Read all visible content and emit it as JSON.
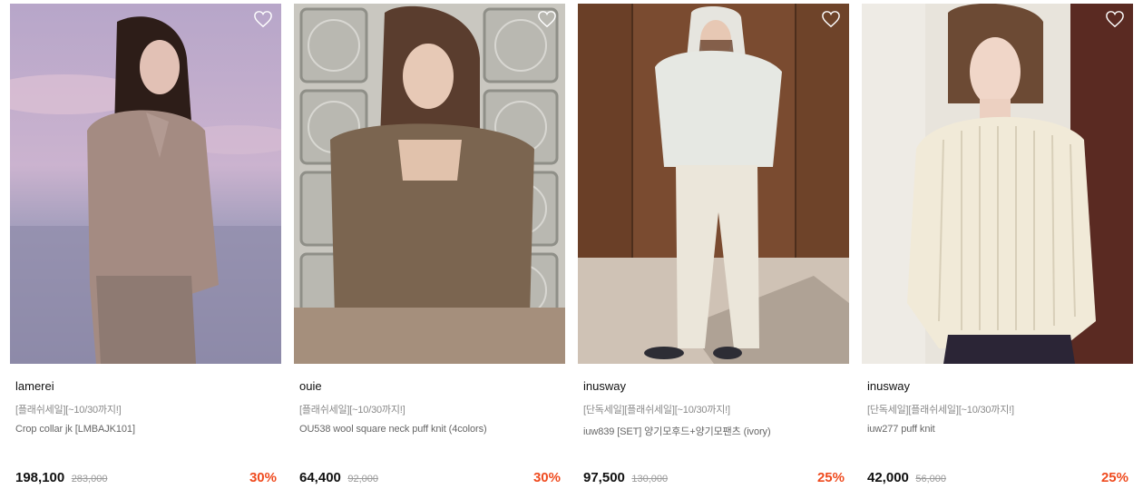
{
  "products": [
    {
      "brand": "lamerei",
      "promo": "[플래쉬세일][~10/30까지!]",
      "name": "Crop collar jk [LMBAJK101]",
      "price": "198,100",
      "original_price": "283,000",
      "discount": "30%"
    },
    {
      "brand": "ouie",
      "promo": "[플래쉬세일][~10/30까지!]",
      "name": "OU538 wool square neck puff knit (4colors)",
      "price": "64,400",
      "original_price": "92,000",
      "discount": "30%"
    },
    {
      "brand": "inusway",
      "promo": "[단독세일][플래쉬세일][~10/30까지!]",
      "name": "iuw839 [SET] 양기모후드+양기모팬츠 (ivory)",
      "price": "97,500",
      "original_price": "130,000",
      "discount": "25%"
    },
    {
      "brand": "inusway",
      "promo": "[단독세일][플래쉬세일][~10/30까지!]",
      "name": "iuw277 puff knit",
      "price": "42,000",
      "original_price": "56,000",
      "discount": "25%"
    }
  ],
  "icons": {
    "wishlist": "heart-outline-icon"
  },
  "colors": {
    "discount": "#ef4b1f",
    "strike_price": "#9a9a9a",
    "promo": "#8a8a8a"
  }
}
